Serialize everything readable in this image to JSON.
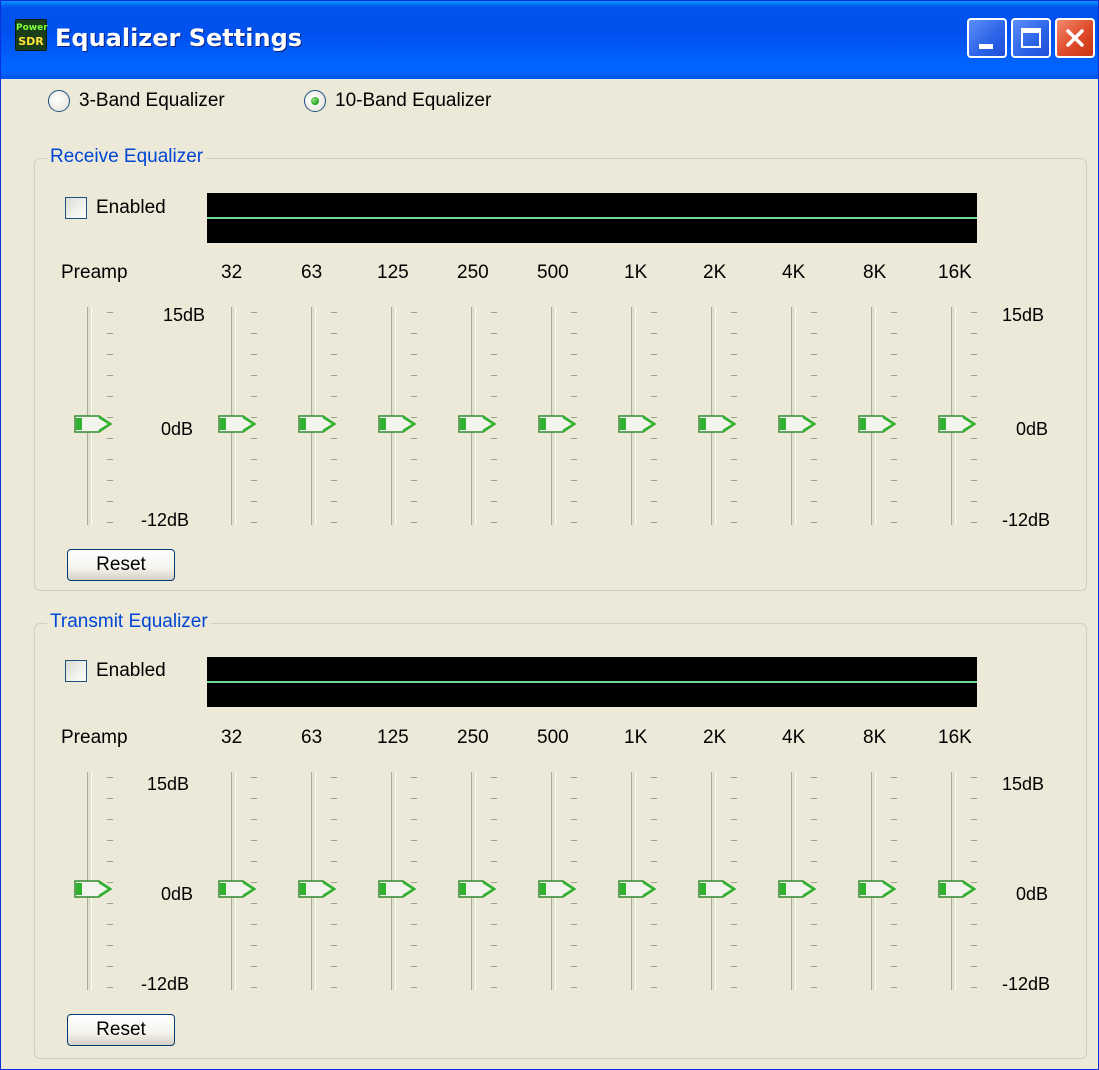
{
  "window": {
    "title": "Equalizer Settings",
    "app_icon_line1": "Power",
    "app_icon_line2": "SDR"
  },
  "mode": {
    "options": [
      {
        "label": "3-Band Equalizer",
        "checked": false
      },
      {
        "label": "10-Band Equalizer",
        "checked": true
      }
    ]
  },
  "groups": [
    {
      "title": "Receive Equalizer",
      "enabled_label": "Enabled",
      "enabled": false,
      "preamp_label": "Preamp",
      "bands": [
        "32",
        "63",
        "125",
        "250",
        "500",
        "1K",
        "2K",
        "4K",
        "8K",
        "16K"
      ],
      "db_top": "15dB",
      "db_mid": "0dB",
      "db_bottom": "-12dB",
      "preamp_value_db": 0,
      "band_values_db": [
        0,
        0,
        0,
        0,
        0,
        0,
        0,
        0,
        0,
        0
      ],
      "reset_label": "Reset"
    },
    {
      "title": "Transmit Equalizer",
      "enabled_label": "Enabled",
      "enabled": false,
      "preamp_label": "Preamp",
      "bands": [
        "32",
        "63",
        "125",
        "250",
        "500",
        "1K",
        "2K",
        "4K",
        "8K",
        "16K"
      ],
      "db_top": "15dB",
      "db_mid": "0dB",
      "db_bottom": "-12dB",
      "preamp_value_db": 0,
      "band_values_db": [
        0,
        0,
        0,
        0,
        0,
        0,
        0,
        0,
        0,
        0
      ],
      "reset_label": "Reset"
    }
  ],
  "colors": {
    "titlebar": "#0054e3",
    "group_title": "#0046d5",
    "display_bg": "#000000",
    "curve": "#71d891",
    "thumb_green": "#2fb12f",
    "window_bg": "#ece9d8"
  }
}
